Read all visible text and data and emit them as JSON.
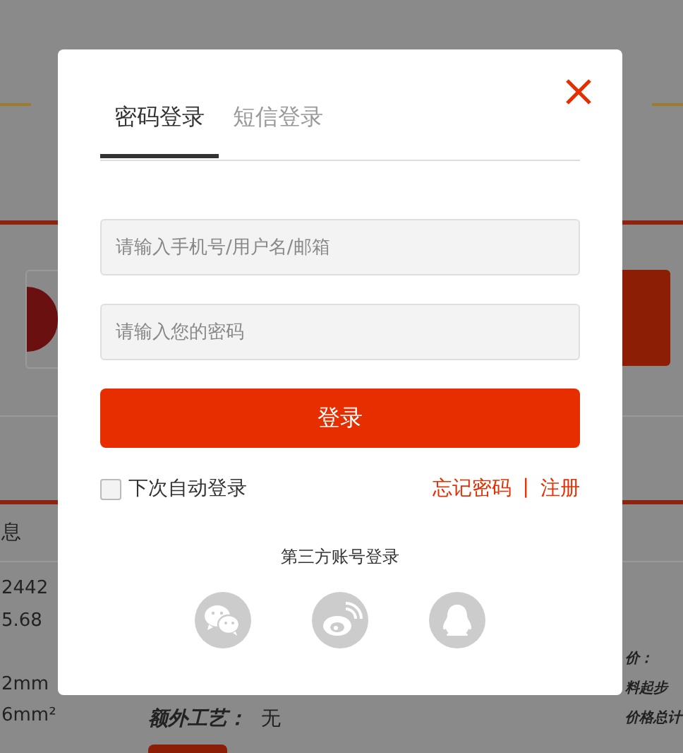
{
  "background": {
    "tab_fragment": "息",
    "spec_lines": [
      "2442",
      "5.68",
      "2mm",
      "6mm²"
    ],
    "extra_process": {
      "label": "额外工艺：",
      "value": "无"
    },
    "price_lines": [
      "价：",
      "料起步",
      "价格总计"
    ]
  },
  "modal": {
    "tabs": [
      {
        "label": "密码登录",
        "selected": true
      },
      {
        "label": "短信登录",
        "selected": false
      }
    ],
    "fields": [
      {
        "placeholder": "请输入手机号/用户名/邮箱"
      },
      {
        "placeholder": "请输入您的密码"
      }
    ],
    "submit": "登录",
    "remember": {
      "label": "下次自动登录",
      "checked": false
    },
    "links": [
      "忘记密码",
      "注册"
    ],
    "separator": "|",
    "third_party": {
      "title": "第三方账号登录",
      "providers": [
        {
          "kind": "wechat"
        },
        {
          "kind": "weibo"
        },
        {
          "kind": "qq"
        }
      ]
    }
  }
}
